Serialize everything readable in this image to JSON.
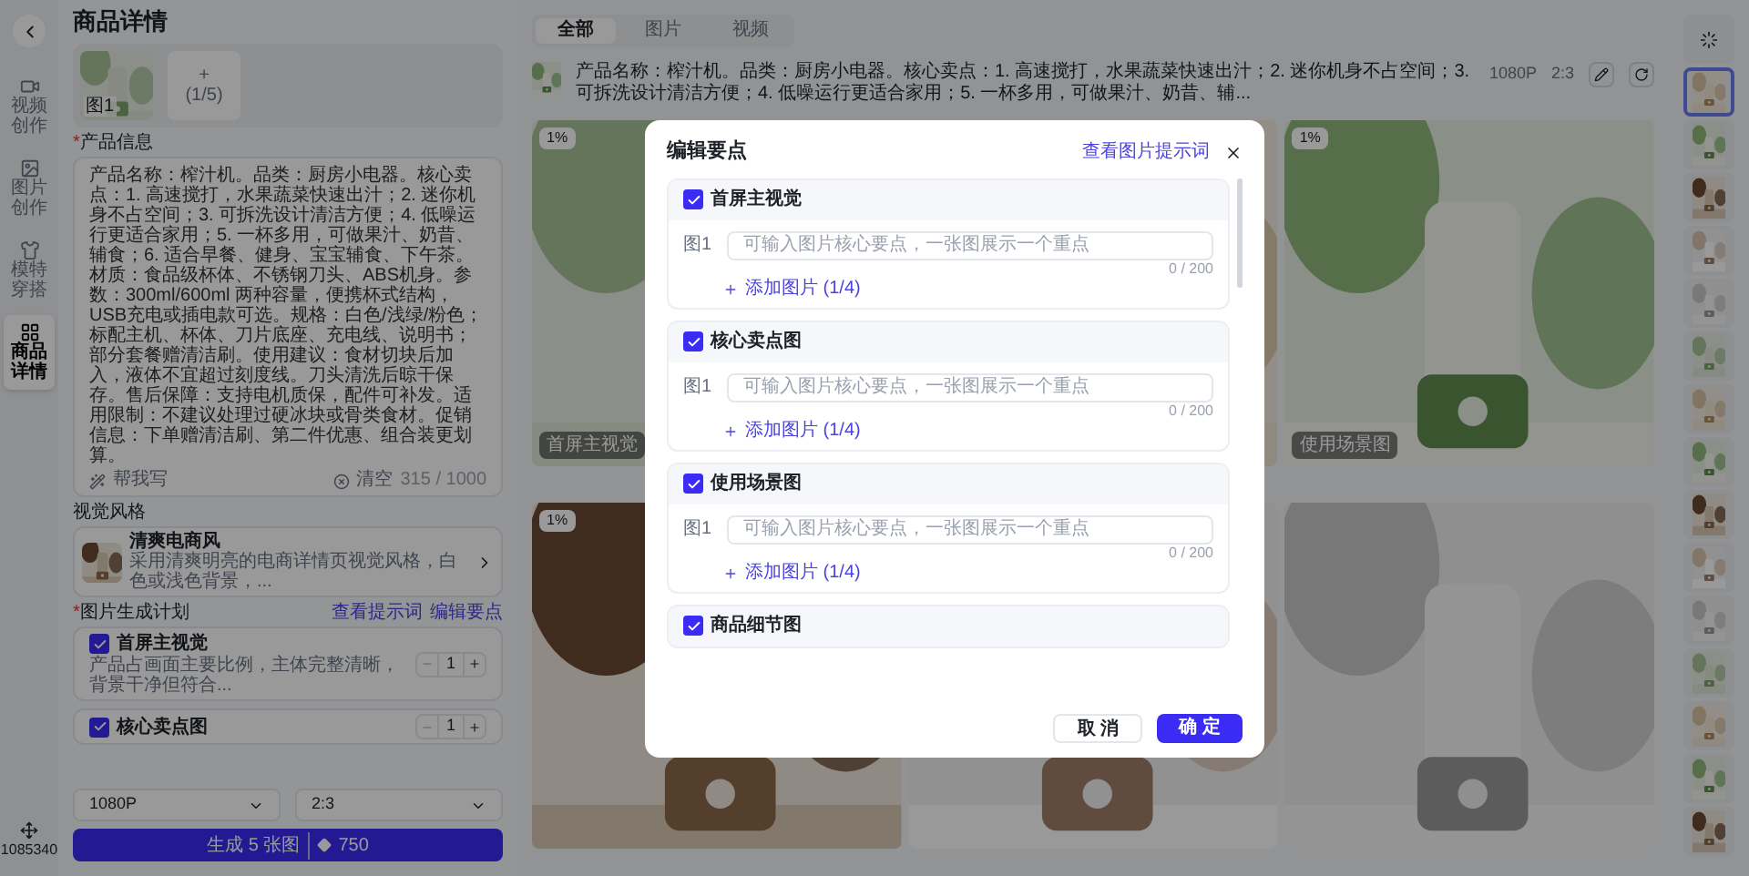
{
  "nav_rail": {
    "items": [
      {
        "label": "视频创作",
        "selected": false
      },
      {
        "label": "图片创作",
        "selected": false
      },
      {
        "label": "模特穿搭",
        "selected": false
      },
      {
        "label": "商品详情",
        "selected": true
      }
    ],
    "credits": "1085340"
  },
  "panel": {
    "title": "商品详情",
    "upload": {
      "image_label": "图1",
      "add_symbol": "+",
      "add_count": "(1/5)"
    },
    "product_info": {
      "marker": "*",
      "label": "产品信息",
      "text": "产品名称：榨汁机。品类：厨房小电器。核心卖点：1. 高速搅打，水果蔬菜快速出汁；2. 迷你机身不占空间；3. 可拆洗设计清洁方便；4. 低噪运行更适合家用；5. 一杯多用，可做果汁、奶昔、辅食；6. 适合早餐、健身、宝宝辅食、下午茶。材质：食品级杯体、不锈钢刀头、ABS机身。参数：300ml/600ml 两种容量，便携杯式结构，USB充电或插电款可选。规格：白色/浅绿/粉色；标配主机、杯体、刀片底座、充电线、说明书；部分套餐赠清洁刷。使用建议：食材切块后加入，液体不宜超过刻度线。刀头清洗后晾干保存。售后保障：支持电机质保，配件可补发。适用限制：不建议处理过硬冰块或骨类食材。促销信息：下单赠清洁刷、第二件优惠、组合装更划算。",
      "assist": "帮我写",
      "clear": "清空",
      "count": "315 / 1000"
    },
    "visual_style": {
      "label": "视觉风格",
      "name": "清爽电商风",
      "desc": "采用清爽明亮的电商详情页视觉风格，白色或浅色背景，..."
    },
    "plan": {
      "marker": "*",
      "label": "图片生成计划",
      "links": [
        "查看提示词",
        "编辑要点"
      ],
      "items": [
        {
          "title": "首屏主视觉",
          "desc": "产品占画面主要比例，主体完整清晰，背景干净但符合...",
          "checked": true,
          "qty": "1"
        },
        {
          "title": "核心卖点图",
          "checked": true,
          "qty": "1"
        }
      ]
    },
    "selects": [
      "1080P",
      "2:3"
    ],
    "generate": {
      "label": "生成 5 张图",
      "cost": "750"
    }
  },
  "main": {
    "tabs": [
      {
        "label": "全部",
        "selected": true
      },
      {
        "label": "图片",
        "selected": false
      },
      {
        "label": "视频",
        "selected": false
      }
    ],
    "prompt": {
      "text": "产品名称：榨汁机。品类：厨房小电器。核心卖点：1. 高速搅打，水果蔬菜快速出汁；2. 迷你机身不占空间；3. 可拆洗设计清洁方便；4. 低噪运行更适合家用；5. 一杯多用，可做果汁、奶昔、辅...",
      "resolution": "1080P",
      "ratio": "2:3"
    },
    "cards": [
      {
        "kind": "picture",
        "badge": "1%",
        "caption": "首屏主视觉"
      },
      {
        "kind": "picture"
      },
      {
        "kind": "picture",
        "badge": "1%",
        "caption": "使用场景图"
      },
      {
        "kind": "picture",
        "badge": "1%"
      },
      {
        "kind": "picture"
      },
      {
        "kind": "picture"
      }
    ]
  },
  "thumbnails": [
    {
      "kind": "loading",
      "selected": false
    },
    {
      "kind": "picture",
      "selected": true
    },
    {
      "kind": "picture",
      "selected": false
    },
    {
      "kind": "picture",
      "selected": false
    },
    {
      "kind": "picture",
      "selected": false
    },
    {
      "kind": "picture",
      "selected": false
    },
    {
      "kind": "picture",
      "selected": false
    },
    {
      "kind": "picture",
      "selected": false
    },
    {
      "kind": "picture",
      "selected": false
    },
    {
      "kind": "picture",
      "selected": false
    },
    {
      "kind": "picture",
      "selected": false
    },
    {
      "kind": "picture",
      "selected": false
    },
    {
      "kind": "picture",
      "selected": false
    },
    {
      "kind": "picture",
      "selected": false
    },
    {
      "kind": "picture",
      "selected": false
    },
    {
      "kind": "picture",
      "selected": false
    }
  ],
  "modal": {
    "title": "编辑要点",
    "link": "查看图片提示词",
    "sections": [
      {
        "title": "首屏主视觉",
        "checked": true,
        "rows": [
          {
            "label": "图1",
            "placeholder": "可输入图片核心要点，一张图展示一个重点",
            "count": "0 / 200"
          }
        ],
        "add": "添加图片 (1/4)"
      },
      {
        "title": "核心卖点图",
        "checked": true,
        "rows": [
          {
            "label": "图1",
            "placeholder": "可输入图片核心要点，一张图展示一个重点",
            "count": "0 / 200"
          }
        ],
        "add": "添加图片 (1/4)"
      },
      {
        "title": "使用场景图",
        "checked": true,
        "rows": [
          {
            "label": "图1",
            "placeholder": "可输入图片核心要点，一张图展示一个重点",
            "count": "0 / 200"
          }
        ],
        "add": "添加图片 (1/4)"
      },
      {
        "title": "商品细节图",
        "checked": true
      }
    ],
    "cancel": "取 消",
    "confirm": "确 定"
  }
}
